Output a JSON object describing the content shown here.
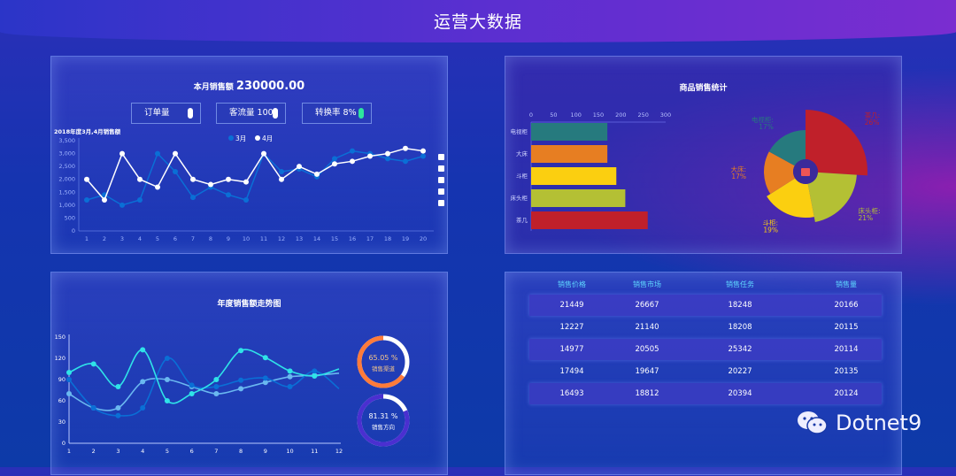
{
  "header": {
    "title": "运营大数据"
  },
  "sales_panel": {
    "label": "本月销售额",
    "amount": "230000.00",
    "kpis": [
      {
        "label": "订单量",
        "icon": "arrow-up-icon",
        "color": "#ffffff"
      },
      {
        "label": "客流量 100",
        "icon": "arrow-up-icon",
        "color": "#ffffff"
      },
      {
        "label": "转换率 8%",
        "icon": "arrow-down-icon",
        "color": "#2ee59d"
      }
    ],
    "toolbox": [
      "download-icon",
      "line-chart-icon",
      "bar-chart-icon",
      "restore-icon",
      "grid-icon"
    ]
  },
  "goods_panel": {
    "title": "商品销售统计"
  },
  "trend_panel": {
    "title": "年度销售额走势图"
  },
  "table_panel": {
    "headers": [
      "销售价格",
      "销售市场",
      "销售任务",
      "销售量"
    ],
    "rows": [
      [
        "21449",
        "26667",
        "18248",
        "20166"
      ],
      [
        "12227",
        "21140",
        "18208",
        "20115"
      ],
      [
        "14977",
        "20505",
        "25342",
        "20114"
      ],
      [
        "17494",
        "19647",
        "20227",
        "20135"
      ],
      [
        "16493",
        "18812",
        "20394",
        "20124"
      ]
    ]
  },
  "watermark": {
    "text": "Dotnet9"
  },
  "chart_data": [
    {
      "type": "line",
      "title": "2018年度3月,4月销售额",
      "x": [
        1,
        2,
        3,
        4,
        5,
        6,
        7,
        8,
        9,
        10,
        11,
        12,
        13,
        14,
        15,
        16,
        17,
        18,
        19,
        20
      ],
      "ylim": [
        0,
        3500
      ],
      "yticks": [
        "0",
        "500",
        "1,000",
        "1,500",
        "2,000",
        "2,500",
        "3,000",
        "3,500"
      ],
      "legend": "top-center",
      "series": [
        {
          "name": "3月",
          "color": "#0a6fd6",
          "values": [
            1200,
            1400,
            1000,
            1200,
            3000,
            2300,
            1300,
            1700,
            1400,
            1200,
            3000,
            2300,
            2400,
            2100,
            2800,
            3100,
            3000,
            2800,
            2700,
            2900
          ]
        },
        {
          "name": "4月",
          "color": "#ffffff",
          "values": [
            2000,
            1200,
            3000,
            2000,
            1700,
            3000,
            2000,
            1800,
            2000,
            1900,
            3000,
            2000,
            2500,
            2200,
            2600,
            2700,
            2900,
            3000,
            3200,
            3100
          ]
        }
      ]
    },
    {
      "type": "bar",
      "orientation": "horizontal",
      "categories": [
        "电视柜",
        "大床",
        "斗柜",
        "床头柜",
        "茶几"
      ],
      "values": [
        170,
        170,
        190,
        210,
        260
      ],
      "xlim": [
        0,
        300
      ],
      "xticks": [
        "0",
        "50",
        "100",
        "150",
        "200",
        "250",
        "300"
      ],
      "colors": [
        "#267a7e",
        "#e77e22",
        "#fbcf10",
        "#b4c034",
        "#c0202a"
      ]
    },
    {
      "type": "pie",
      "variant": "rose",
      "center_icon": "gift-icon",
      "slices": [
        {
          "label": "茶几",
          "pct": "26%",
          "value": 26,
          "color": "#c0202a"
        },
        {
          "label": "床头柜",
          "pct": "21%",
          "value": 21,
          "color": "#b4c034"
        },
        {
          "label": "斗柜",
          "pct": "19%",
          "value": 19,
          "color": "#fbcf10"
        },
        {
          "label": "大床",
          "pct": "17%",
          "value": 17,
          "color": "#e77e22"
        },
        {
          "label": "电视柜",
          "pct": "17%",
          "value": 17,
          "color": "#267a7e"
        }
      ]
    },
    {
      "type": "line",
      "smooth": true,
      "x": [
        1,
        2,
        3,
        4,
        5,
        6,
        7,
        8,
        9,
        10,
        11,
        12
      ],
      "ylim": [
        0,
        150
      ],
      "yticks": [
        "0",
        "30",
        "60",
        "90",
        "120",
        "150"
      ],
      "series": [
        {
          "color": "#2fe3e8",
          "values": [
            100,
            112,
            80,
            132,
            60,
            70,
            90,
            131,
            121,
            102,
            95,
            105
          ]
        },
        {
          "color": "#0a6fd6",
          "values": [
            90,
            50,
            39,
            50,
            120,
            82,
            80,
            89,
            92,
            80,
            102,
            77
          ]
        },
        {
          "color": "#6ab8f0",
          "values": [
            70,
            50,
            50,
            87,
            90,
            80,
            70,
            77,
            86,
            94,
            96,
            99
          ]
        }
      ]
    },
    {
      "type": "pie",
      "variant": "gauge",
      "items": [
        {
          "value": 65.05,
          "label": "65.05 %",
          "name": "销售渠道",
          "color": "#ff7b3a",
          "text_color": "#f5c68a"
        },
        {
          "value": 81.31,
          "label": "81.31 %",
          "name": "销售方向",
          "color": "#4a2fd0",
          "text_color": "#ffffff"
        }
      ]
    }
  ]
}
